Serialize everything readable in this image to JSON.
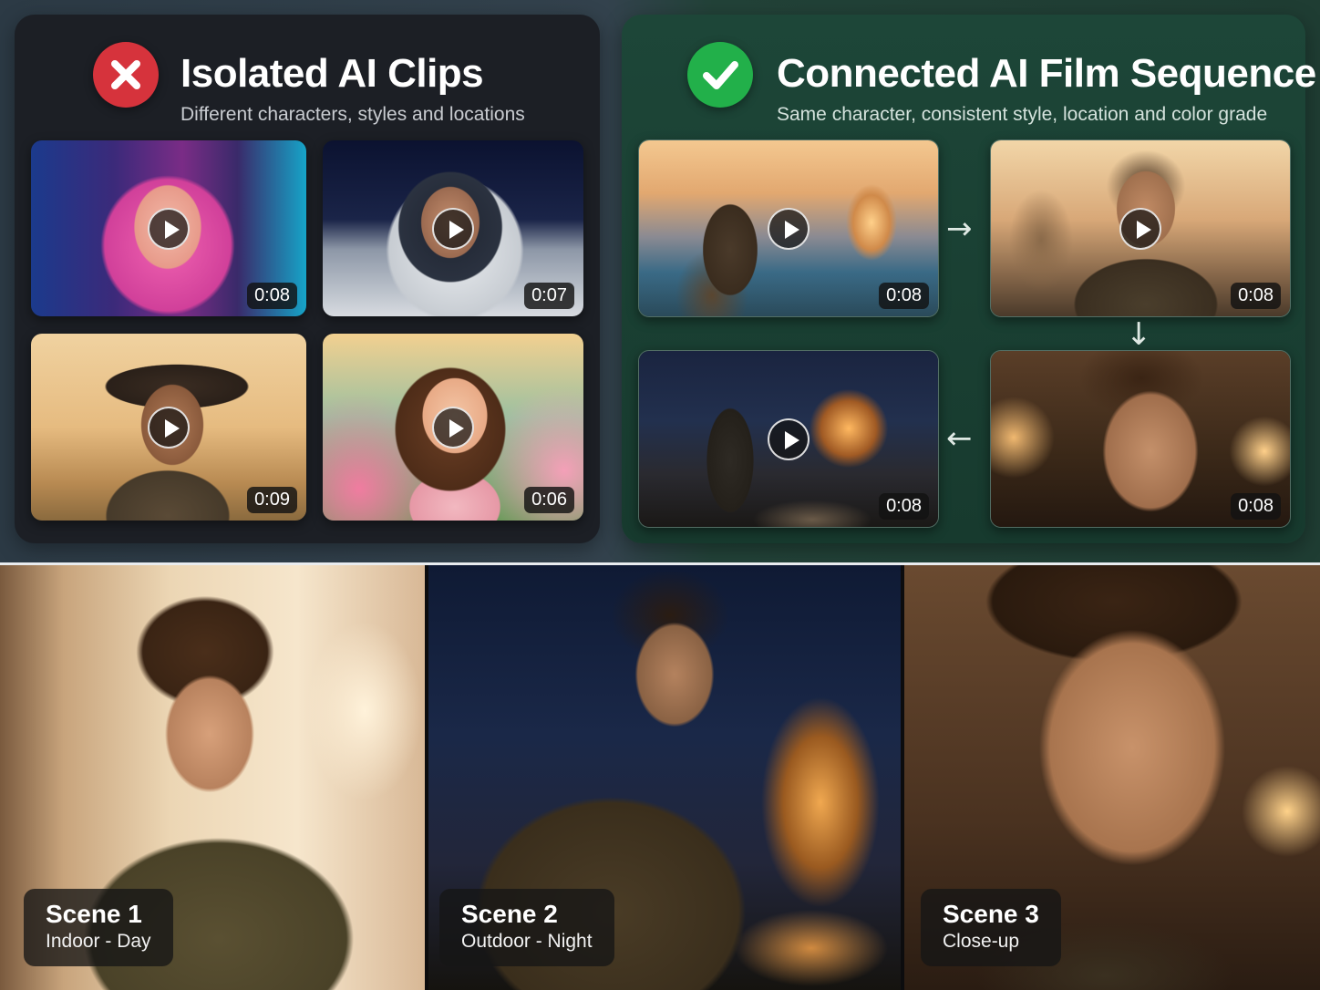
{
  "left_panel": {
    "title": "Isolated AI Clips",
    "subtitle": "Different characters, styles and locations",
    "badge_icon": "x-icon",
    "badge_color": "#d6333c",
    "clips": [
      {
        "duration": "0:08",
        "subject": "pink-haired woman, neon city"
      },
      {
        "duration": "0:07",
        "subject": "astronaut on moon"
      },
      {
        "duration": "0:09",
        "subject": "cowboy in field"
      },
      {
        "duration": "0:06",
        "subject": "animated girl with flowers"
      }
    ]
  },
  "right_panel": {
    "title": "Connected AI Film Sequence",
    "subtitle": "Same character, consistent style, location and color grade",
    "badge_icon": "check-icon",
    "badge_color": "#22b04a",
    "clips": [
      {
        "duration": "0:08",
        "subject": "traveler facing castle at sunset"
      },
      {
        "duration": "0:08",
        "subject": "traveler portrait, castle behind"
      },
      {
        "duration": "0:08",
        "subject": "traveler walking to castle at night"
      },
      {
        "duration": "0:08",
        "subject": "traveler close-up, candlelight"
      }
    ]
  },
  "scenes": [
    {
      "title": "Scene 1",
      "subtitle": "Indoor - Day"
    },
    {
      "title": "Scene 2",
      "subtitle": "Outdoor - Night"
    },
    {
      "title": "Scene 3",
      "subtitle": "Close-up"
    }
  ]
}
